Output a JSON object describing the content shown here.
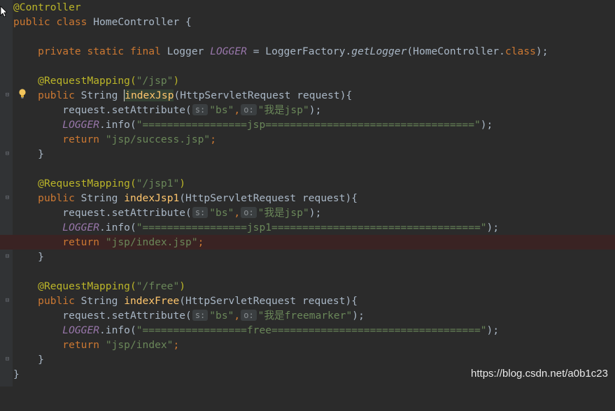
{
  "code": {
    "l1": "@Controller",
    "l2_kw": "public class",
    "l2_name": "HomeController {",
    "l4_kw": "private static final",
    "l4_type": "Logger",
    "l4_const": "LOGGER",
    "l4_eq": " = LoggerFactory.",
    "l4_call": "getLogger",
    "l4_arg": "(HomeController.",
    "l4_class_kw": "class",
    "l4_end": ");",
    "m1": {
      "annotation": "@RequestMapping(",
      "path": "\"/jsp\"",
      "close": ")",
      "sig_kw": "public",
      "sig_type": "String",
      "name": "indexJsp",
      "params": "(HttpServletRequest request){",
      "set_call": "request.setAttribute(",
      "hint_s": "s:",
      "arg1": "\"bs\"",
      "comma": ",",
      "hint_o": "o:",
      "arg2": "\"我是jsp\"",
      "set_end": ");",
      "log_const": "LOGGER",
      "log_call": ".info(",
      "log_str": "\"=================jsp==================================\"",
      "log_end": ");",
      "ret_kw": "return",
      "ret_str": "\"jsp/success.jsp\"",
      "ret_end": ";",
      "brace": "}"
    },
    "m2": {
      "annotation": "@RequestMapping(",
      "path": "\"/jsp1\"",
      "close": ")",
      "sig_kw": "public",
      "sig_type": "String",
      "name": "indexJsp1",
      "params": "(HttpServletRequest request){",
      "set_call": "request.setAttribute(",
      "hint_s": "s:",
      "arg1": "\"bs\"",
      "comma": ",",
      "hint_o": "o:",
      "arg2": "\"我是jsp\"",
      "set_end": ");",
      "log_const": "LOGGER",
      "log_call": ".info(",
      "log_str": "\"=================jsp1==================================\"",
      "log_end": ");",
      "ret_kw": "return",
      "ret_str": "\"jsp/index.jsp\"",
      "ret_end": ";",
      "brace": "}"
    },
    "m3": {
      "annotation": "@RequestMapping(",
      "path": "\"/free\"",
      "close": ")",
      "sig_kw": "public",
      "sig_type": "String",
      "name": "indexFree",
      "params": "(HttpServletRequest request){",
      "set_call": "request.setAttribute(",
      "hint_s": "s:",
      "arg1": "\"bs\"",
      "comma": ",",
      "hint_o": "o:",
      "arg2": "\"我是freemarker\"",
      "set_end": ");",
      "log_const": "LOGGER",
      "log_call": ".info(",
      "log_str": "\"=================free==================================\"",
      "log_end": ");",
      "ret_kw": "return",
      "ret_str": "\"jsp/index\"",
      "ret_end": ";",
      "brace": "}"
    },
    "class_close": "}"
  },
  "watermark": "https://blog.csdn.net/a0b1c23",
  "icons": {
    "bulb": "lightbulb-icon",
    "fold": "fold-marker-icon",
    "cursor": "mouse-cursor-icon"
  },
  "colors": {
    "background": "#2b2b2b",
    "keyword": "#cc7832",
    "string": "#6a8759",
    "annotation": "#bbb529",
    "method": "#ffc66d",
    "constant": "#9876aa",
    "breakpoint_line": "#3a2323"
  }
}
